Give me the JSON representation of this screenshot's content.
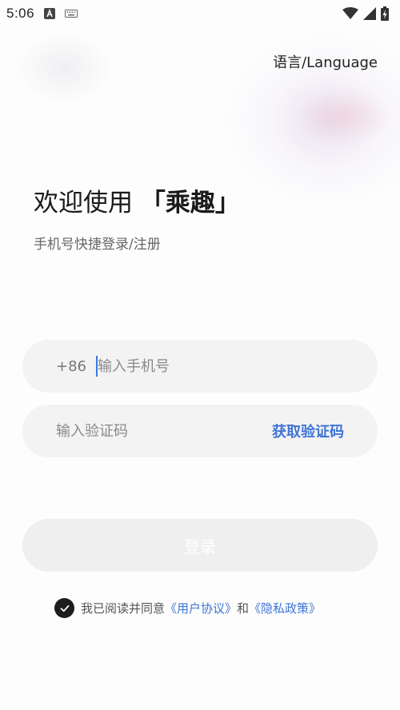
{
  "status_bar": {
    "time": "5:06",
    "icons": [
      "a-notification-icon",
      "keyboard-icon",
      "wifi-icon",
      "signal-icon",
      "battery-charging-icon"
    ]
  },
  "header": {
    "language_label": "语言/Language"
  },
  "welcome": {
    "title_prefix": "欢迎使用 ",
    "brand_name": "「乘趣」",
    "subtitle": "手机号快捷登录/注册"
  },
  "phone_field": {
    "country_code": "+86",
    "value": "",
    "placeholder": "输入手机号"
  },
  "code_field": {
    "value": "",
    "placeholder": "输入验证码",
    "get_code_label": "获取验证码"
  },
  "login_button": {
    "label": "登录"
  },
  "agreement": {
    "checked": true,
    "text_prefix": "我已阅读并同意",
    "user_agreement": "《用户协议》",
    "conjunction": "和",
    "privacy_policy": "《隐私政策》"
  },
  "colors": {
    "accent": "#3f74d6",
    "field_bg": "#f3f3f3",
    "checkbox": "#1d1d1d"
  }
}
